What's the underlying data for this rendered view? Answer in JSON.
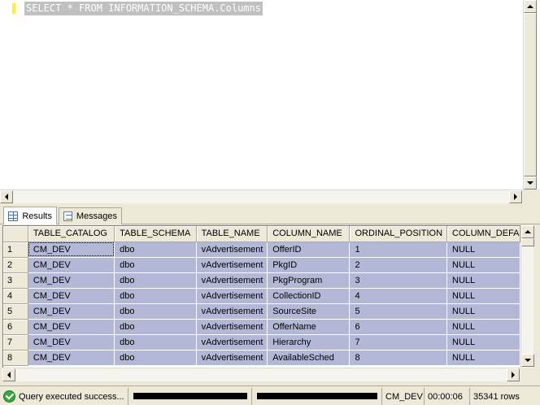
{
  "editor": {
    "query": "SELECT * FROM INFORMATION_SCHEMA.Columns"
  },
  "tabs": [
    {
      "label": "Results",
      "icon": "results-grid-icon",
      "active": true
    },
    {
      "label": "Messages",
      "icon": "messages-icon",
      "active": false
    }
  ],
  "grid": {
    "columns": [
      "TABLE_CATALOG",
      "TABLE_SCHEMA",
      "TABLE_NAME",
      "COLUMN_NAME",
      "ORDINAL_POSITION",
      "COLUMN_DEFA"
    ],
    "rows": [
      {
        "num": "1",
        "cells": [
          "CM_DEV",
          "dbo",
          "vAdvertisement",
          "OfferID",
          "1",
          "NULL"
        ]
      },
      {
        "num": "2",
        "cells": [
          "CM_DEV",
          "dbo",
          "vAdvertisement",
          "PkgID",
          "2",
          "NULL"
        ]
      },
      {
        "num": "3",
        "cells": [
          "CM_DEV",
          "dbo",
          "vAdvertisement",
          "PkgProgram",
          "3",
          "NULL"
        ]
      },
      {
        "num": "4",
        "cells": [
          "CM_DEV",
          "dbo",
          "vAdvertisement",
          "CollectionID",
          "4",
          "NULL"
        ]
      },
      {
        "num": "5",
        "cells": [
          "CM_DEV",
          "dbo",
          "vAdvertisement",
          "SourceSite",
          "5",
          "NULL"
        ]
      },
      {
        "num": "6",
        "cells": [
          "CM_DEV",
          "dbo",
          "vAdvertisement",
          "OfferName",
          "6",
          "NULL"
        ]
      },
      {
        "num": "7",
        "cells": [
          "CM_DEV",
          "dbo",
          "vAdvertisement",
          "Hierarchy",
          "7",
          "NULL"
        ]
      },
      {
        "num": "8",
        "cells": [
          "CM_DEV",
          "dbo",
          "vAdvertisement",
          "AvailableSched",
          "8",
          "NULL"
        ]
      }
    ]
  },
  "status": {
    "message": "Query executed success...",
    "database": "CM_DEV",
    "elapsed": "00:00:06",
    "rows": "35341 rows",
    "ok_color": "#3fa53f"
  }
}
